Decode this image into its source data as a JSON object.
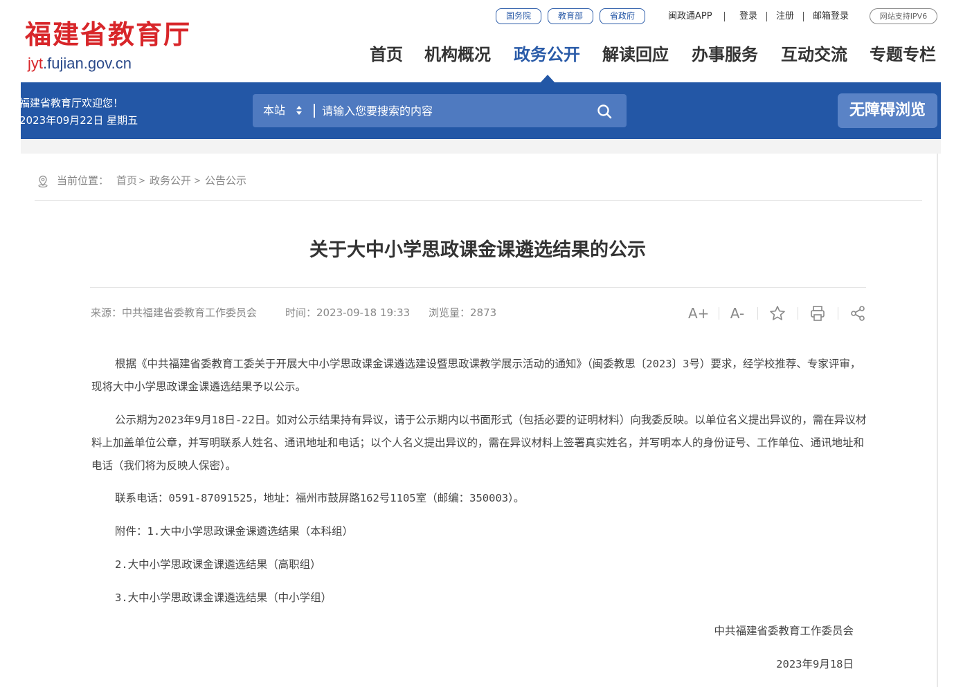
{
  "header": {
    "logo_title": "福建省教育厅",
    "logo_url_prefix": "jyt",
    "logo_url_rest": ".fujian.gov.cn",
    "top_pills": [
      "国务院",
      "教育部",
      "省政府"
    ],
    "top_links": [
      "闽政通APP",
      "登录",
      "注册",
      "邮箱登录"
    ],
    "ipv6_badge": "网站支持IPV6"
  },
  "nav": {
    "items": [
      "首页",
      "机构概况",
      "政务公开",
      "解读回应",
      "办事服务",
      "互动交流",
      "专题专栏"
    ],
    "active_index": 2
  },
  "band": {
    "welcome": "福建省教育厅欢迎您！",
    "date": "2023年09月22日 星期五",
    "search_scope": "本站",
    "search_placeholder": "请输入您要搜索的内容",
    "accessibility_button": "无障碍浏览"
  },
  "breadcrumb": {
    "label": "当前位置：",
    "items": [
      "首页",
      "政务公开",
      "公告公示"
    ],
    "separator": ">"
  },
  "article": {
    "title": "关于大中小学思政课金课遴选结果的公示",
    "source": "来源：中共福建省委教育工作委员会",
    "time": "时间：2023-09-18 19:33",
    "views": "浏览量：2873",
    "paragraphs": [
      "根据《中共福建省委教育工委关于开展大中小学思政课金课遴选建设暨思政课教学展示活动的通知》（闽委教思〔2023〕3号）要求，经学校推荐、专家评审，现将大中小学思政课金课遴选结果予以公示。",
      "公示期为2023年9月18日-22日。如对公示结果持有异议，请于公示期内以书面形式（包括必要的证明材料）向我委反映。以单位名义提出异议的，需在异议材料上加盖单位公章，并写明联系人姓名、通讯地址和电话；以个人名义提出异议的，需在异议材料上签署真实姓名，并写明本人的身份证号、工作单位、通讯地址和电话（我们将为反映人保密）。"
    ],
    "contact": "联系电话：0591-87091525，地址：福州市鼓屏路162号1105室（邮编：350003）。",
    "attachments": [
      "附件：1.大中小学思政课金课遴选结果（本科组）",
      "2.大中小学思政课金课遴选结果（高职组）",
      "3.大中小学思政课金课遴选结果（中小学组）"
    ],
    "signature": "中共福建省委教育工作委员会",
    "sign_date": "2023年9月18日"
  },
  "tools": {
    "font_up": "A+",
    "font_down": "A-"
  },
  "colors": {
    "brand_red": "#d8262a",
    "brand_blue": "#2357a6",
    "active_nav": "#2a5ba8"
  }
}
